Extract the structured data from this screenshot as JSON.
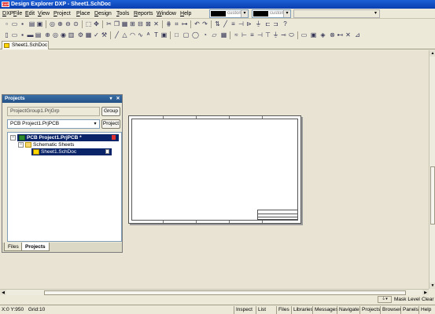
{
  "window": {
    "title": "Design Explorer DXP - Sheet1.SchDoc",
    "app_icon_label": "DXP"
  },
  "menu": {
    "items": [
      "DXP",
      "File",
      "Edit",
      "View",
      "Project",
      "Place",
      "Design",
      "Tools",
      "Reports",
      "Window",
      "Help"
    ],
    "color_combo_1": "custom",
    "color_combo_2": "custom"
  },
  "toolbar_icons": {
    "row1": [
      "new-icon",
      "open-icon",
      "save-icon",
      "print-icon",
      "print-preview-icon",
      "zoom-icon",
      "zoom-in-icon",
      "zoom-out-icon",
      "zoom-fit-icon",
      "cut-icon",
      "copy-icon",
      "paste-icon",
      "select-icon",
      "move-icon",
      "undo-icon",
      "redo-icon",
      "wire-icon",
      "bus-icon",
      "netlabel-icon",
      "port-icon",
      "power-icon",
      "help-icon"
    ],
    "row2": [
      "new-sheet-icon",
      "open-sheet-icon",
      "save-sheet-icon",
      "print-icon",
      "browse-icon",
      "line-icon",
      "polygon-icon",
      "arc-icon",
      "bezier-icon",
      "text-icon",
      "image-icon",
      "rectangle-icon",
      "ellipse-icon",
      "pie-icon",
      "graph-icon",
      "component-icon",
      "pin-icon",
      "junction-icon",
      "delete-icon"
    ]
  },
  "document_tabs": [
    "Sheet1.SchDoc"
  ],
  "projects_panel": {
    "title": "Projects",
    "project_group": "ProjectGroup1.PrjGrp",
    "group_button": "Group",
    "project_selected": "PCB Project1.PrjPCB",
    "project_button": "Project",
    "tree": {
      "project": "PCB Project1.PrjPCB *",
      "folder": "Schematic Sheets",
      "document": "Sheet1.SchDoc"
    },
    "tabs": [
      "Files",
      "Projects"
    ],
    "active_tab": "Projects"
  },
  "status": {
    "coordinates": "X:0 Y:950",
    "grid": "Grid:10",
    "mask_level": "Mask Level",
    "clear": "Clear",
    "buttons": [
      "Inspect",
      "List",
      "Files",
      "Libraries",
      "Messages",
      "Navigate",
      "Projects",
      "Browser",
      "Panels",
      "Help"
    ]
  },
  "colors": {
    "title_bar": "#0a3fb0",
    "selection": "#0a246a",
    "workspace": "#e8e3d3"
  }
}
